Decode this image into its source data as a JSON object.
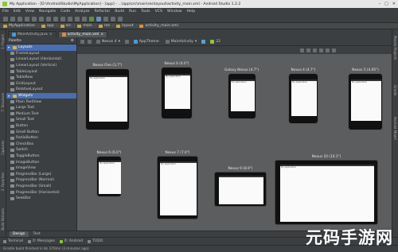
{
  "window": {
    "title": "My Application - [D:\\AndroidStudio\\MyApplication] - [app] - ...\\app\\src\\main\\res\\layout\\activity_main.xml - Android Studio 1.2.2",
    "controls": [
      "–",
      "□",
      "✕"
    ]
  },
  "menu": [
    "File",
    "Edit",
    "View",
    "Navigate",
    "Code",
    "Analyze",
    "Refactor",
    "Build",
    "Run",
    "Tools",
    "VCS",
    "Window",
    "Help"
  ],
  "navbar": [
    "MyApplication",
    "app",
    "src",
    "main",
    "res",
    "layout",
    "activity_main.xml"
  ],
  "file_tabs": [
    {
      "label": "MainActivity.java",
      "active": false
    },
    {
      "label": "activity_main.xml",
      "active": true
    }
  ],
  "left_tool_tabs": [
    "1: Project",
    "7: Structure",
    "Captures",
    "2: Favorites",
    "Build Variants"
  ],
  "right_tool_tabs": [
    "Maven Projects",
    "Gradle",
    "Android Model"
  ],
  "palette": {
    "title": "Palette",
    "groups": [
      {
        "label": "Layouts",
        "items": [
          "FrameLayout",
          "LinearLayout (Horizontal)",
          "LinearLayout (Vertical)",
          "TableLayout",
          "TableRow",
          "GridLayout",
          "RelativeLayout"
        ]
      },
      {
        "label": "Widgets",
        "items": [
          "Plain TextView",
          "Large Text",
          "Medium Text",
          "Small Text",
          "Button",
          "Small Button",
          "RadioButton",
          "CheckBox",
          "Switch",
          "ToggleButton",
          "ImageButton",
          "ImageView",
          "ProgressBar (Large)",
          "ProgressBar (Normal)",
          "ProgressBar (Small)",
          "ProgressBar (Horizontal)",
          "SeekBar"
        ]
      }
    ]
  },
  "canvas_toolbar": {
    "device": "Nexus 4",
    "theme": "AppTheme",
    "activity": "MainActivity",
    "api": "22"
  },
  "devices": [
    {
      "label": "",
      "screen_title": "My Application",
      "type": "phone"
    },
    {
      "label": "Nexus One (3.7\")",
      "screen_title": "My Application",
      "type": "phone"
    },
    {
      "label": "Nexus S (4.0\")",
      "screen_title": "My Application",
      "type": "phone"
    },
    {
      "label": "Galaxy Nexus (4.7\")",
      "screen_title": "My Application",
      "type": "phone"
    },
    {
      "label": "Nexus 4 (4.7\")",
      "screen_title": "My Application",
      "type": "phone"
    },
    {
      "label": "Nexus 5 (4.95\")",
      "screen_title": "My Application",
      "type": "phone"
    },
    {
      "label": "Nexus 6 (6.0\")",
      "screen_title": "My Application",
      "type": "phone"
    },
    {
      "label": "Nexus 7 (7.0\")",
      "screen_title": "My Application",
      "type": "tablet"
    },
    {
      "label": "Nexus 9 (8.9\")",
      "screen_title": "",
      "type": "tablet"
    },
    {
      "label": "Nexus 10 (10.1\")",
      "screen_title": "My Application",
      "type": "tablet"
    }
  ],
  "bottom_tabs": [
    {
      "label": "Design",
      "active": true
    },
    {
      "label": "Text",
      "active": false
    }
  ],
  "tool_windows": [
    "Terminal",
    "0: Messages",
    "6: Android",
    "TODO"
  ],
  "status": "Gradle build finished in 8s 370ms (3 minutes ago)",
  "watermark": "元码手游网"
}
